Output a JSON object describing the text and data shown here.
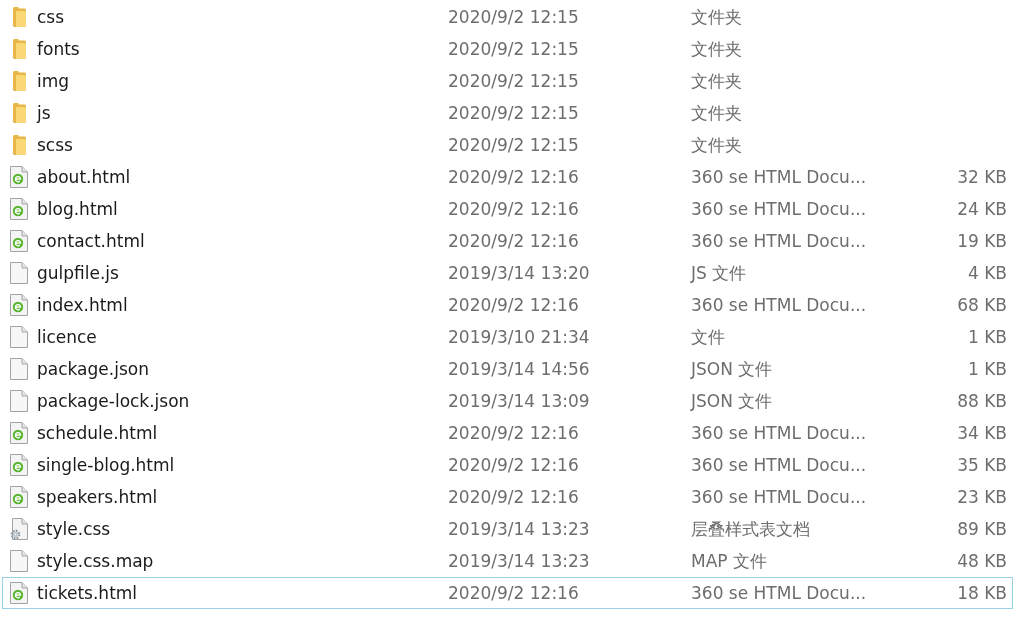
{
  "files": [
    {
      "kind": "folder",
      "name": "css",
      "modified": "2020/9/2 12:15",
      "type": "文件夹",
      "focused": false
    },
    {
      "kind": "folder",
      "name": "fonts",
      "modified": "2020/9/2 12:15",
      "type": "文件夹",
      "focused": false
    },
    {
      "kind": "folder",
      "name": "img",
      "modified": "2020/9/2 12:15",
      "type": "文件夹",
      "focused": false
    },
    {
      "kind": "folder",
      "name": "js",
      "modified": "2020/9/2 12:15",
      "type": "文件夹",
      "focused": false
    },
    {
      "kind": "folder",
      "name": "scss",
      "modified": "2020/9/2 12:15",
      "type": "文件夹",
      "focused": false
    },
    {
      "kind": "html",
      "name": "about.html",
      "modified": "2020/9/2 12:16",
      "type": "360 se HTML Docu...",
      "size": "32 KB",
      "focused": false
    },
    {
      "kind": "html",
      "name": "blog.html",
      "modified": "2020/9/2 12:16",
      "type": "360 se HTML Docu...",
      "size": "24 KB",
      "focused": false
    },
    {
      "kind": "html",
      "name": "contact.html",
      "modified": "2020/9/2 12:16",
      "type": "360 se HTML Docu...",
      "size": "19 KB",
      "focused": false
    },
    {
      "kind": "file",
      "name": "gulpfile.js",
      "modified": "2019/3/14 13:20",
      "type": "JS 文件",
      "size": "4 KB",
      "focused": false
    },
    {
      "kind": "html",
      "name": "index.html",
      "modified": "2020/9/2 12:16",
      "type": "360 se HTML Docu...",
      "size": "68 KB",
      "focused": false
    },
    {
      "kind": "file",
      "name": "licence",
      "modified": "2019/3/10 21:34",
      "type": "文件",
      "size": "1 KB",
      "focused": false
    },
    {
      "kind": "file",
      "name": "package.json",
      "modified": "2019/3/14 14:56",
      "type": "JSON 文件",
      "size": "1 KB",
      "focused": false
    },
    {
      "kind": "file",
      "name": "package-lock.json",
      "modified": "2019/3/14 13:09",
      "type": "JSON 文件",
      "size": "88 KB",
      "focused": false
    },
    {
      "kind": "html",
      "name": "schedule.html",
      "modified": "2020/9/2 12:16",
      "type": "360 se HTML Docu...",
      "size": "34 KB",
      "focused": false
    },
    {
      "kind": "html",
      "name": "single-blog.html",
      "modified": "2020/9/2 12:16",
      "type": "360 se HTML Docu...",
      "size": "35 KB",
      "focused": false
    },
    {
      "kind": "html",
      "name": "speakers.html",
      "modified": "2020/9/2 12:16",
      "type": "360 se HTML Docu...",
      "size": "23 KB",
      "focused": false
    },
    {
      "kind": "css",
      "name": "style.css",
      "modified": "2019/3/14 13:23",
      "type": "层叠样式表文档",
      "size": "89 KB",
      "focused": false
    },
    {
      "kind": "file",
      "name": "style.css.map",
      "modified": "2019/3/14 13:23",
      "type": "MAP 文件",
      "size": "48 KB",
      "focused": false
    },
    {
      "kind": "html",
      "name": "tickets.html",
      "modified": "2020/9/2 12:16",
      "type": "360 se HTML Docu...",
      "size": "18 KB",
      "focused": true
    }
  ]
}
